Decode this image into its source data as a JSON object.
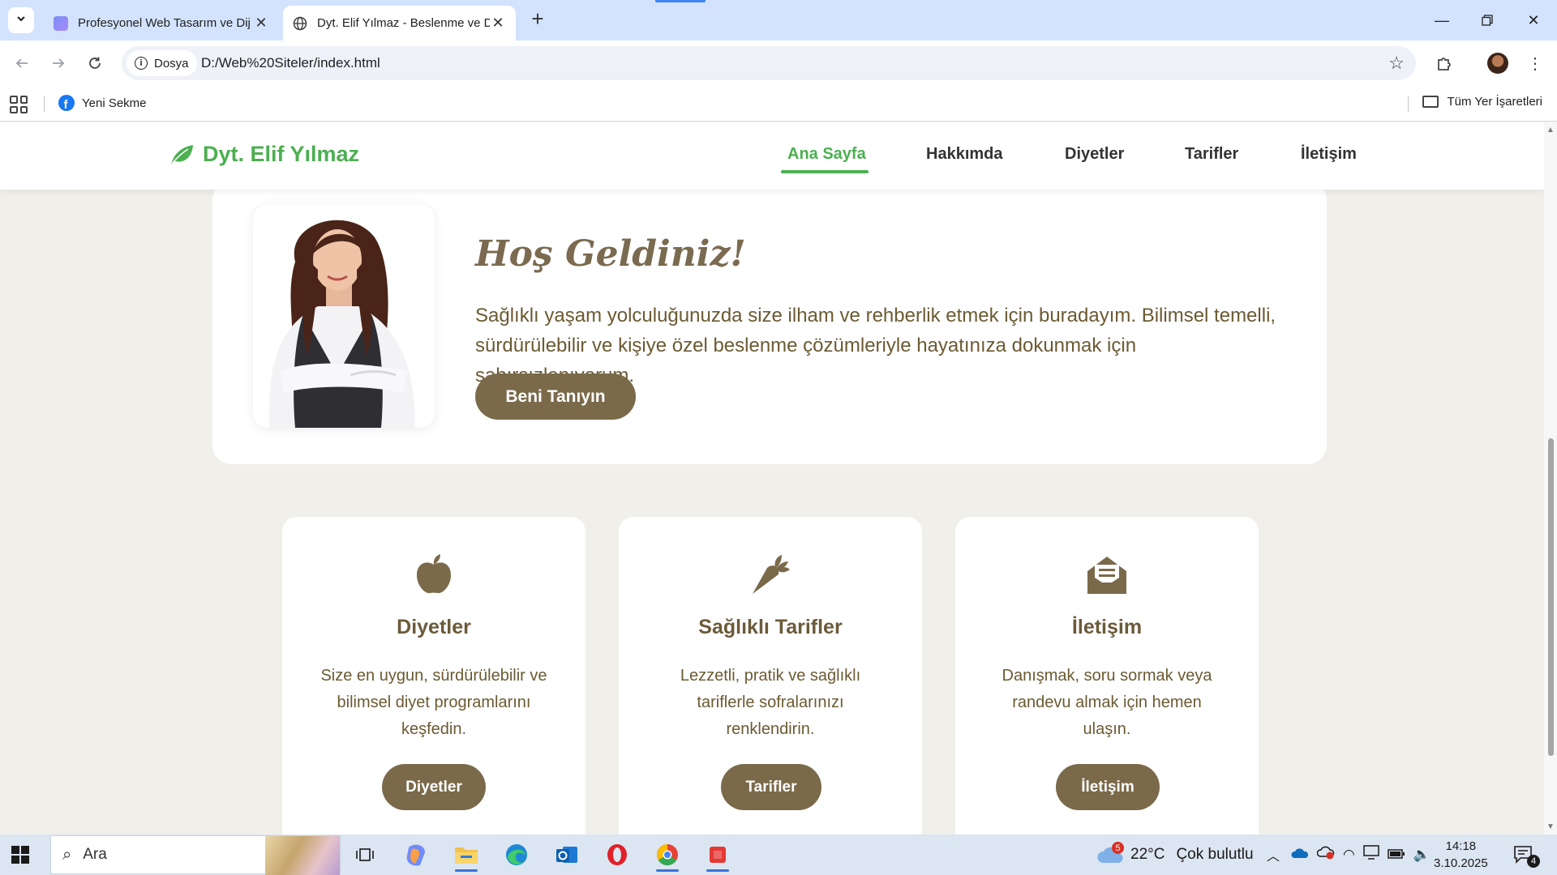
{
  "browser": {
    "tabs": [
      {
        "title": "Profesyonel Web Tasarım ve Dij",
        "active": false
      },
      {
        "title": "Dyt. Elif Yılmaz - Beslenme ve D",
        "active": true
      }
    ],
    "site_chip": "Dosya",
    "url": "D:/Web%20Siteler/index.html",
    "bookmarks": [
      {
        "label": "Yeni Sekme"
      }
    ],
    "all_bookmarks": "Tüm Yer İşaretleri"
  },
  "site": {
    "brand": "Dyt. Elif Yılmaz",
    "nav": [
      "Ana Sayfa",
      "Hakkımda",
      "Diyetler",
      "Tarifler",
      "İletişim"
    ],
    "active_nav": "Ana Sayfa",
    "hero": {
      "title": "Hoş Geldiniz!",
      "text": "Sağlıklı yaşam yolculuğunuzda size ilham ve rehberlik etmek için buradayım. Bilimsel temelli, sürdürülebilir ve kişiye özel beslenme çözümleriyle hayatınıza dokunmak için sabırsızlanıyorum.",
      "button": "Beni Tanıyın"
    },
    "cards": [
      {
        "icon": "apple-icon",
        "title": "Diyetler",
        "text": "Size en uygun, sürdürülebilir ve bilimsel diyet programlarını keşfedin.",
        "button": "Diyetler"
      },
      {
        "icon": "carrot-icon",
        "title": "Sağlıklı Tarifler",
        "text": "Lezzetli, pratik ve sağlıklı tariflerle sofralarınızı renklendirin.",
        "button": "Tarifler"
      },
      {
        "icon": "envelope-open-text-icon",
        "title": "İletişim",
        "text": "Danışmak, soru sormak veya randevu almak için hemen ulaşın.",
        "button": "İletişim"
      }
    ],
    "colors": {
      "brand_green": "#4caf50",
      "button_brown": "#7a6a4a",
      "background": "#f1efea"
    }
  },
  "taskbar": {
    "search_placeholder": "Ara",
    "weather": {
      "temp": "22°C",
      "condition": "Çok bulutlu",
      "badge": "5"
    },
    "time": "14:18",
    "date": "3.10.2025",
    "notifications": "4"
  }
}
